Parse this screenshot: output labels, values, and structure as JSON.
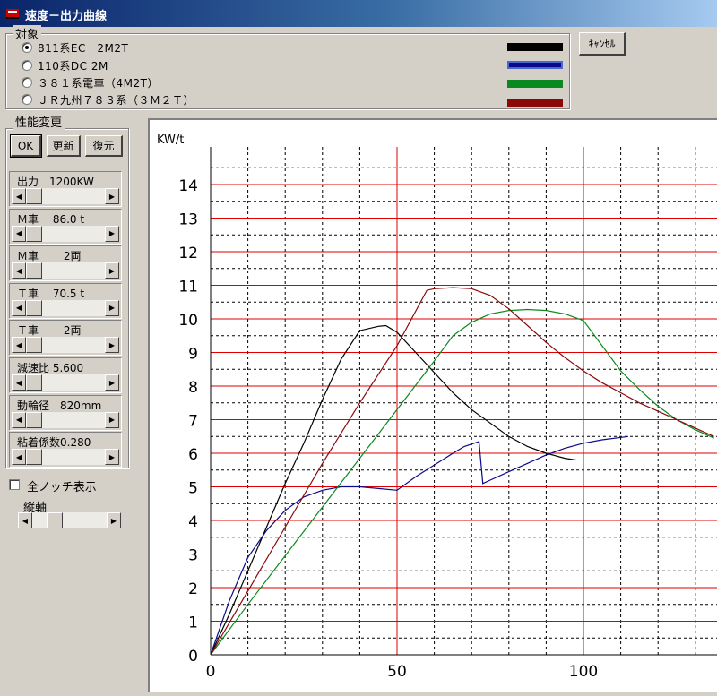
{
  "window": {
    "title": "速度－出力曲線"
  },
  "target_group": {
    "label": "対象",
    "items": [
      {
        "label": "811系EC　2M2T",
        "checked": true,
        "color": "#000000"
      },
      {
        "label": "110系DC 2M",
        "checked": false,
        "color": "#0a0a8a"
      },
      {
        "label": "３８１系電車（4M2T）",
        "checked": false,
        "color": "#0a8a1e"
      },
      {
        "label": "ＪＲ九州７８３系（３Ｍ２Ｔ）",
        "checked": false,
        "color": "#8a0a0a"
      }
    ]
  },
  "cancel_button": "ｷｬﾝｾﾙ",
  "performance_group": {
    "label": "性能変更",
    "ok_label": "OK",
    "update_label": "更新",
    "restore_label": "復元",
    "params": [
      {
        "label": "出力　1200KW",
        "pos": 0.0
      },
      {
        "label": "Ｍ車　 86.0 t",
        "pos": 0.0
      },
      {
        "label": "Ｍ車　　 2両",
        "pos": 0.0
      },
      {
        "label": "Ｔ車　 70.5 t",
        "pos": 0.0
      },
      {
        "label": "Ｔ車　　 2両",
        "pos": 0.0
      },
      {
        "label": "減速比 5.600",
        "pos": 0.0
      },
      {
        "label": "動輪径　820mm",
        "pos": 0.0
      },
      {
        "label": "粘着係数0.280",
        "pos": 0.0
      }
    ]
  },
  "all_notch": {
    "label": "全ノッチ表示",
    "checked": false
  },
  "vertical_axis": {
    "label": "縦軸",
    "pos": 0.25
  },
  "chart_data": {
    "type": "line",
    "ylabel": "KW/t",
    "xlabel": "",
    "xlim": [
      0,
      135
    ],
    "ylim": [
      0,
      15
    ],
    "xticks": [
      0,
      50,
      100
    ],
    "yticks": [
      0,
      1,
      2,
      3,
      4,
      5,
      6,
      7,
      8,
      9,
      10,
      11,
      12,
      13,
      14
    ],
    "grid": true,
    "series": [
      {
        "color": "#000000",
        "x": [
          0,
          5,
          10,
          15,
          20,
          25,
          30,
          35,
          40,
          45,
          47,
          50,
          55,
          60,
          65,
          70,
          75,
          80,
          85,
          90,
          95,
          98
        ],
        "y": [
          0,
          1.2,
          2.5,
          3.8,
          5.1,
          6.3,
          7.6,
          8.8,
          9.65,
          9.78,
          9.8,
          9.6,
          9.0,
          8.4,
          7.8,
          7.3,
          6.9,
          6.5,
          6.2,
          6.0,
          5.85,
          5.8
        ]
      },
      {
        "color": "#0a0a8a",
        "x": [
          0,
          5,
          10,
          15,
          20,
          25,
          30,
          35,
          40,
          45,
          50,
          55,
          60,
          65,
          68,
          72,
          73,
          75,
          80,
          85,
          90,
          95,
          100,
          105,
          112
        ],
        "y": [
          0,
          1.6,
          2.9,
          3.7,
          4.3,
          4.7,
          4.9,
          5.0,
          5.0,
          4.95,
          4.9,
          5.3,
          5.65,
          6.0,
          6.2,
          6.35,
          5.1,
          5.2,
          5.45,
          5.7,
          5.95,
          6.15,
          6.3,
          6.4,
          6.5
        ]
      },
      {
        "color": "#0a8a1e",
        "x": [
          0,
          10,
          20,
          30,
          40,
          50,
          60,
          65,
          70,
          75,
          80,
          85,
          90,
          95,
          100,
          105,
          110,
          115,
          120,
          125,
          130,
          135
        ],
        "y": [
          0,
          1.5,
          2.95,
          4.4,
          5.85,
          7.3,
          8.75,
          9.5,
          9.9,
          10.15,
          10.25,
          10.28,
          10.25,
          10.15,
          9.95,
          9.2,
          8.45,
          7.9,
          7.4,
          7.0,
          6.7,
          6.45
        ]
      },
      {
        "color": "#8a0a0a",
        "x": [
          0,
          10,
          20,
          30,
          40,
          50,
          58,
          60,
          65,
          70,
          75,
          80,
          85,
          90,
          95,
          100,
          105,
          110,
          115,
          120,
          125,
          130,
          135
        ],
        "y": [
          0,
          1.9,
          3.8,
          5.7,
          7.5,
          9.2,
          10.85,
          10.9,
          10.93,
          10.9,
          10.7,
          10.3,
          9.8,
          9.3,
          8.85,
          8.45,
          8.1,
          7.8,
          7.5,
          7.25,
          7.0,
          6.75,
          6.5
        ]
      }
    ]
  }
}
